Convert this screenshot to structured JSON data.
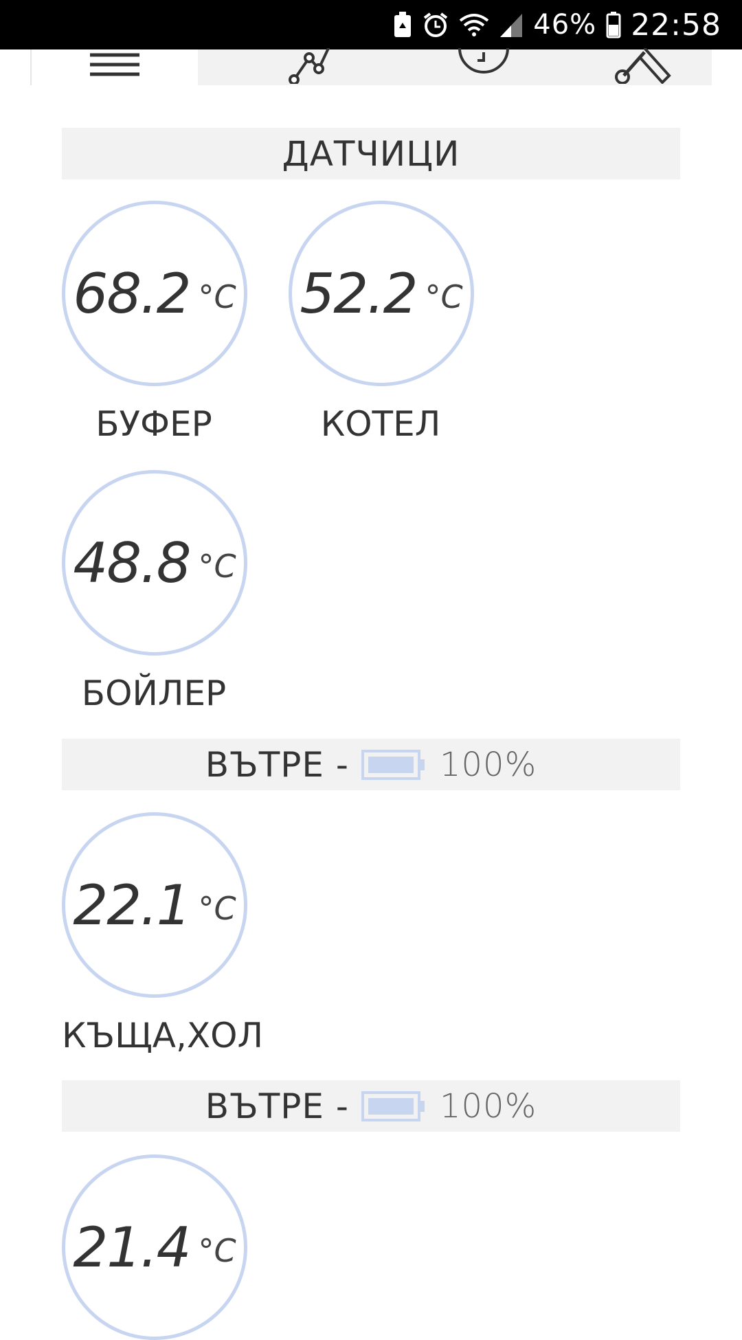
{
  "status_bar": {
    "battery_percent": "46%",
    "time": "22:58",
    "icons": [
      "battery-saver-icon",
      "alarm-icon",
      "wifi-icon",
      "signal-icon",
      "battery-icon"
    ]
  },
  "tabs": [
    {
      "icon": "menu-icon",
      "active": true
    },
    {
      "icon": "graph-icon",
      "active": false
    },
    {
      "icon": "clock-icon",
      "active": false
    },
    {
      "icon": "tools-icon",
      "active": false
    }
  ],
  "sections": {
    "sensors_title": "ДАТЧИЦИ",
    "inside1_title": "ВЪТРЕ -",
    "inside1_battery": "100%",
    "inside2_title": "ВЪТРЕ -",
    "inside2_battery": "100%"
  },
  "sensors": [
    {
      "value": "68.2",
      "unit": "°C",
      "label": "БУФЕР"
    },
    {
      "value": "52.2",
      "unit": "°C",
      "label": "КОТЕЛ"
    },
    {
      "value": "48.8",
      "unit": "°C",
      "label": "БОЙЛЕР"
    },
    {
      "value": "22.1",
      "unit": "°C",
      "label": "КЪЩА,ХОЛ"
    },
    {
      "value": "21.4",
      "unit": "°C",
      "label": ""
    }
  ],
  "colors": {
    "gauge_ring": "#c7d5f0",
    "section_bg": "#f2f2f2",
    "battery_fill": "#c7d5f0"
  }
}
